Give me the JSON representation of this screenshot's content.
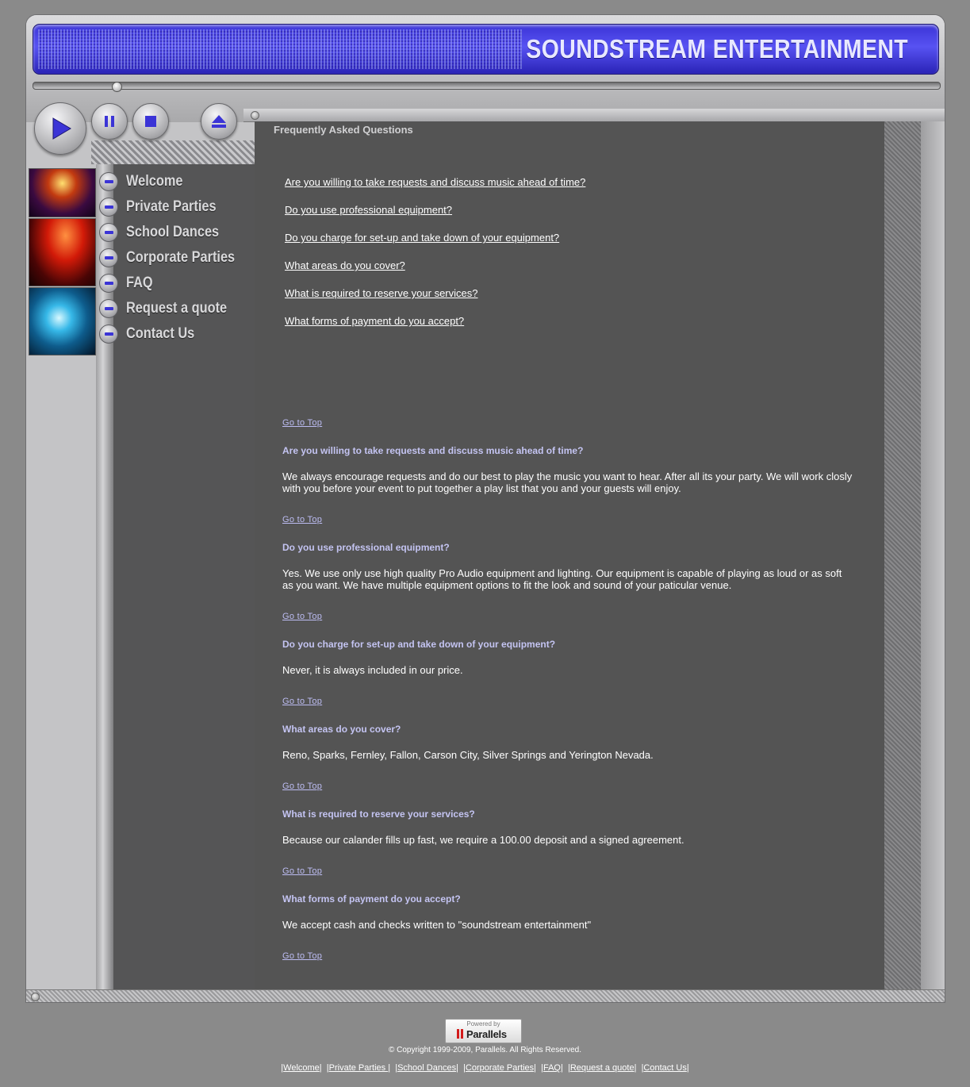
{
  "header": {
    "title": "SOUNDSTREAM ENTERTAINMENT"
  },
  "player": {
    "buttons": [
      "play-icon",
      "pause-icon",
      "stop-icon",
      "eject-icon"
    ]
  },
  "nav": {
    "items": [
      {
        "label": "Welcome"
      },
      {
        "label": "Private Parties"
      },
      {
        "label": "School Dances"
      },
      {
        "label": "Corporate Parties"
      },
      {
        "label": "FAQ"
      },
      {
        "label": "Request a quote"
      },
      {
        "label": "Contact Us"
      }
    ]
  },
  "page": {
    "title": "Frequently Asked Questions",
    "faq_links": [
      "Are you willing to take requests and discuss music ahead of time?",
      "Do you use professional equipment?",
      "Do you charge for set-up and take down of your equipment?",
      "What areas do you cover?",
      "What is required to reserve your services?",
      "What forms of payment do you accept?"
    ],
    "go_to_top": "Go to Top",
    "answers": [
      {
        "q": "Are you willing to take requests and discuss music ahead of time?",
        "a": "We always encourage requests and do our best to play the music you want to hear. After all its your party. We will work closly with you before your event to put together a play list that you and your guests will enjoy."
      },
      {
        "q": "Do you use professional equipment?",
        "a": "Yes. We use only use high quality Pro Audio equipment and lighting. Our equipment is capable of playing as loud or as soft as you want. We have multiple equipment options to fit the look and sound of your paticular venue."
      },
      {
        "q": "Do you charge for set-up and take down of your equipment?",
        "a": "Never, it is always included in our price."
      },
      {
        "q": "What areas do you cover?",
        "a": "Reno, Sparks, Fernley, Fallon, Carson City, Silver Springs and Yerington Nevada."
      },
      {
        "q": "What is required to reserve your services?",
        "a": "Because our calander fills up fast, we require a 100.00 deposit and a signed agreement."
      },
      {
        "q": "What forms of payment do you accept?",
        "a": "We accept cash and checks written to \"soundstream entertainment\""
      }
    ]
  },
  "footer": {
    "badge_top": "Powered by",
    "badge_name": "Parallels",
    "copyright": "© Copyright 1999-2009, Parallels. All Rights Reserved.",
    "links": [
      "Welcome",
      "Private Parties ",
      "School Dances",
      "Corporate Parties",
      "FAQ",
      "Request a quote",
      "Contact Us"
    ]
  }
}
